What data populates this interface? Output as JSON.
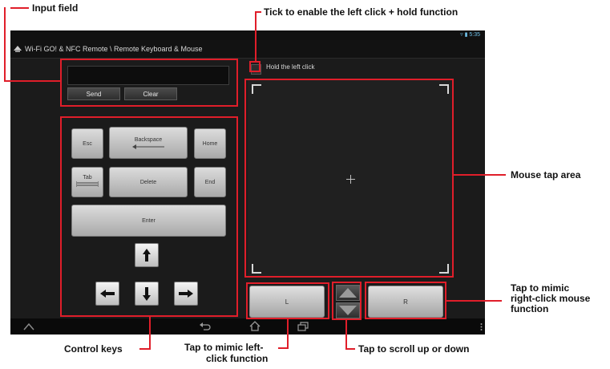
{
  "app": {
    "title": "Wi-Fi GO! & NFC Remote \\ Remote Keyboard & Mouse",
    "status_time": "5:35"
  },
  "input_panel": {
    "input_value": "",
    "send_label": "Send",
    "clear_label": "Clear"
  },
  "keys": {
    "esc": "Esc",
    "backspace": "Backspace",
    "home": "Home",
    "tab": "Tab",
    "delete": "Delete",
    "end": "End",
    "enter": "Enter"
  },
  "mouse": {
    "hold_left_click_label": "Hold the left click",
    "hold_left_click_checked": false,
    "left_label": "L",
    "right_label": "R"
  },
  "callouts": {
    "input_field": "Input field",
    "tick_hold": "Tick to enable the left click + hold function",
    "mouse_tap_area": "Mouse tap area",
    "right_click_line1": "Tap to mimic",
    "right_click_line2": "right-click mouse",
    "right_click_line3": "function",
    "control_keys": "Control keys",
    "left_click_line1": "Tap to mimic left-",
    "left_click_line2": "click function",
    "scroll": "Tap to scroll up or down"
  },
  "colors": {
    "annotation_red": "#e01e2a",
    "screen_bg": "#1b1b1b",
    "status_accent": "#6fc0e8"
  },
  "icons": [
    "wifi-icon",
    "battery-icon",
    "app-icon",
    "home-nav-icon",
    "back-nav-icon",
    "recent-apps-icon",
    "menu-dots-icon",
    "crosshair-icon",
    "arrow-up-icon",
    "arrow-down-icon",
    "arrow-left-icon",
    "arrow-right-icon"
  ]
}
